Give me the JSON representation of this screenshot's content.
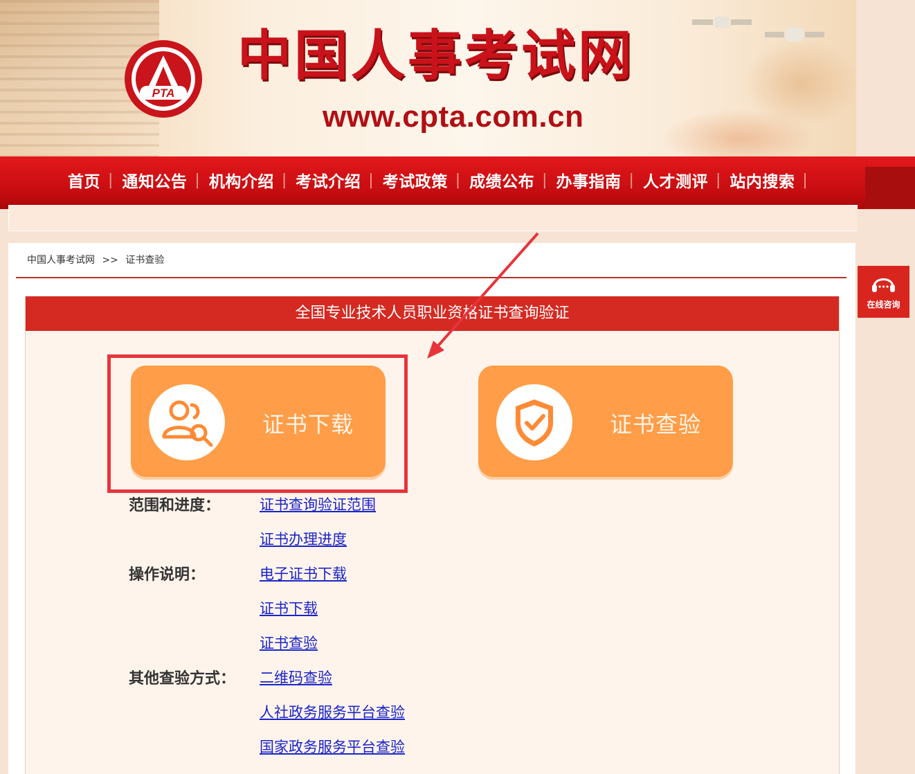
{
  "header": {
    "logo_text": "PTA",
    "site_title": "中国人事考试网",
    "site_url": "www.cpta.com.cn"
  },
  "nav": {
    "items": [
      "首页",
      "通知公告",
      "机构介绍",
      "考试介绍",
      "考试政策",
      "成绩公布",
      "办事指南",
      "人才测评",
      "站内搜索"
    ],
    "separator": "|"
  },
  "breadcrumb": {
    "home": "中国人事考试网",
    "sep": ">>",
    "current": "证书查验"
  },
  "panel": {
    "title": "全国专业技术人员职业资格证书查询验证",
    "download_label": "证书下载",
    "verify_label": "证书查验"
  },
  "info": {
    "scope_label": "范围和进度：",
    "scope_link1": "证书查询验证范围",
    "scope_link2": "证书办理进度",
    "ops_label": "操作说明：",
    "ops_link1": "电子证书下载",
    "ops_link2": "证书下载",
    "ops_link3": "证书查验",
    "other_label": "其他查验方式：",
    "other_link1": "二维码查验",
    "other_link2": "人社政务服务平台查验",
    "other_link3": "国家政务服务平台查验"
  },
  "chat": {
    "label": "在线咨询",
    "icon": "headset-icon"
  },
  "colors": {
    "brand_red": "#d42a22",
    "button_orange": "#ff9d48",
    "link_blue": "#1a24c9",
    "highlight_red": "#e8333b"
  }
}
